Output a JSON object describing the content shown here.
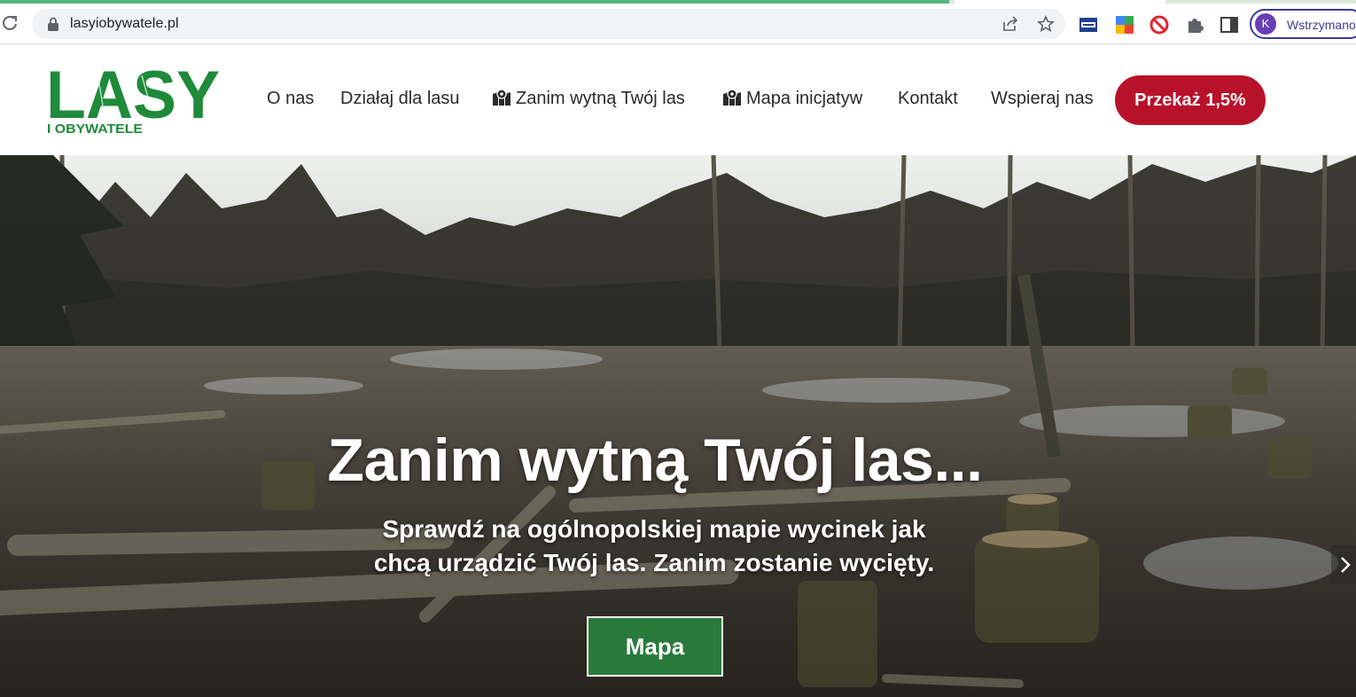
{
  "browser": {
    "url": "lasyiobywatele.pl",
    "profile_initial": "K",
    "profile_label": "Wstrzymano"
  },
  "site": {
    "logo_text": "LASY",
    "logo_subtext": "I OBYWATELE",
    "nav": [
      {
        "label": "O nas",
        "icon": "none"
      },
      {
        "label": "Działaj dla lasu",
        "icon": "none"
      },
      {
        "label": "Zanim wytną Twój las",
        "icon": "map-marker-icon"
      },
      {
        "label": "Mapa inicjatyw",
        "icon": "map-marker-icon"
      },
      {
        "label": "Kontakt",
        "icon": "none"
      },
      {
        "label": "Wspieraj nas",
        "icon": "none"
      }
    ],
    "donate_label": "Przekaż 1,5%"
  },
  "hero": {
    "title": "Zanim wytną Twój las...",
    "subtitle_line1": "Sprawdź na ogólnopolskiej mapie wycinek jak",
    "subtitle_line2": "chcą urządzić Twój las. Zanim zostanie wycięty.",
    "button_label": "Mapa"
  },
  "page_load": {
    "progress": 0.7
  },
  "colors": {
    "brand_green": "#1f8a3a",
    "donate_red": "#b8122a",
    "button_green": "#2a7a3b"
  }
}
